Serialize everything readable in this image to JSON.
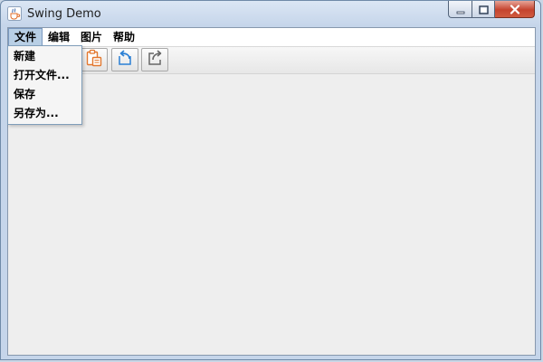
{
  "window": {
    "title": "Swing Demo",
    "app_icon": "java-coffee-cup-icon",
    "controls": {
      "minimize_icon": "minimize-icon",
      "maximize_icon": "maximize-icon",
      "close_icon": "close-icon"
    }
  },
  "menubar": {
    "items": [
      {
        "label": "文件",
        "open": true
      },
      {
        "label": "编辑",
        "open": false
      },
      {
        "label": "图片",
        "open": false
      },
      {
        "label": "帮助",
        "open": false
      }
    ]
  },
  "file_menu": {
    "items": [
      {
        "label": "新建"
      },
      {
        "label": "打开文件..."
      },
      {
        "label": "保存"
      },
      {
        "label": "另存为..."
      }
    ]
  },
  "toolbar": {
    "buttons": [
      {
        "icon": "paste-icon",
        "color": "#e2772e"
      },
      {
        "icon": "undo-arrow-icon",
        "color": "#2a7fd4"
      },
      {
        "icon": "share-arrow-icon",
        "color": "#666666"
      }
    ]
  },
  "colors": {
    "titlebar": "#c5d5ea",
    "client_bg": "#eeeeee",
    "menu_highlight": "#b8cfe5",
    "close_button": "#c5432e"
  }
}
